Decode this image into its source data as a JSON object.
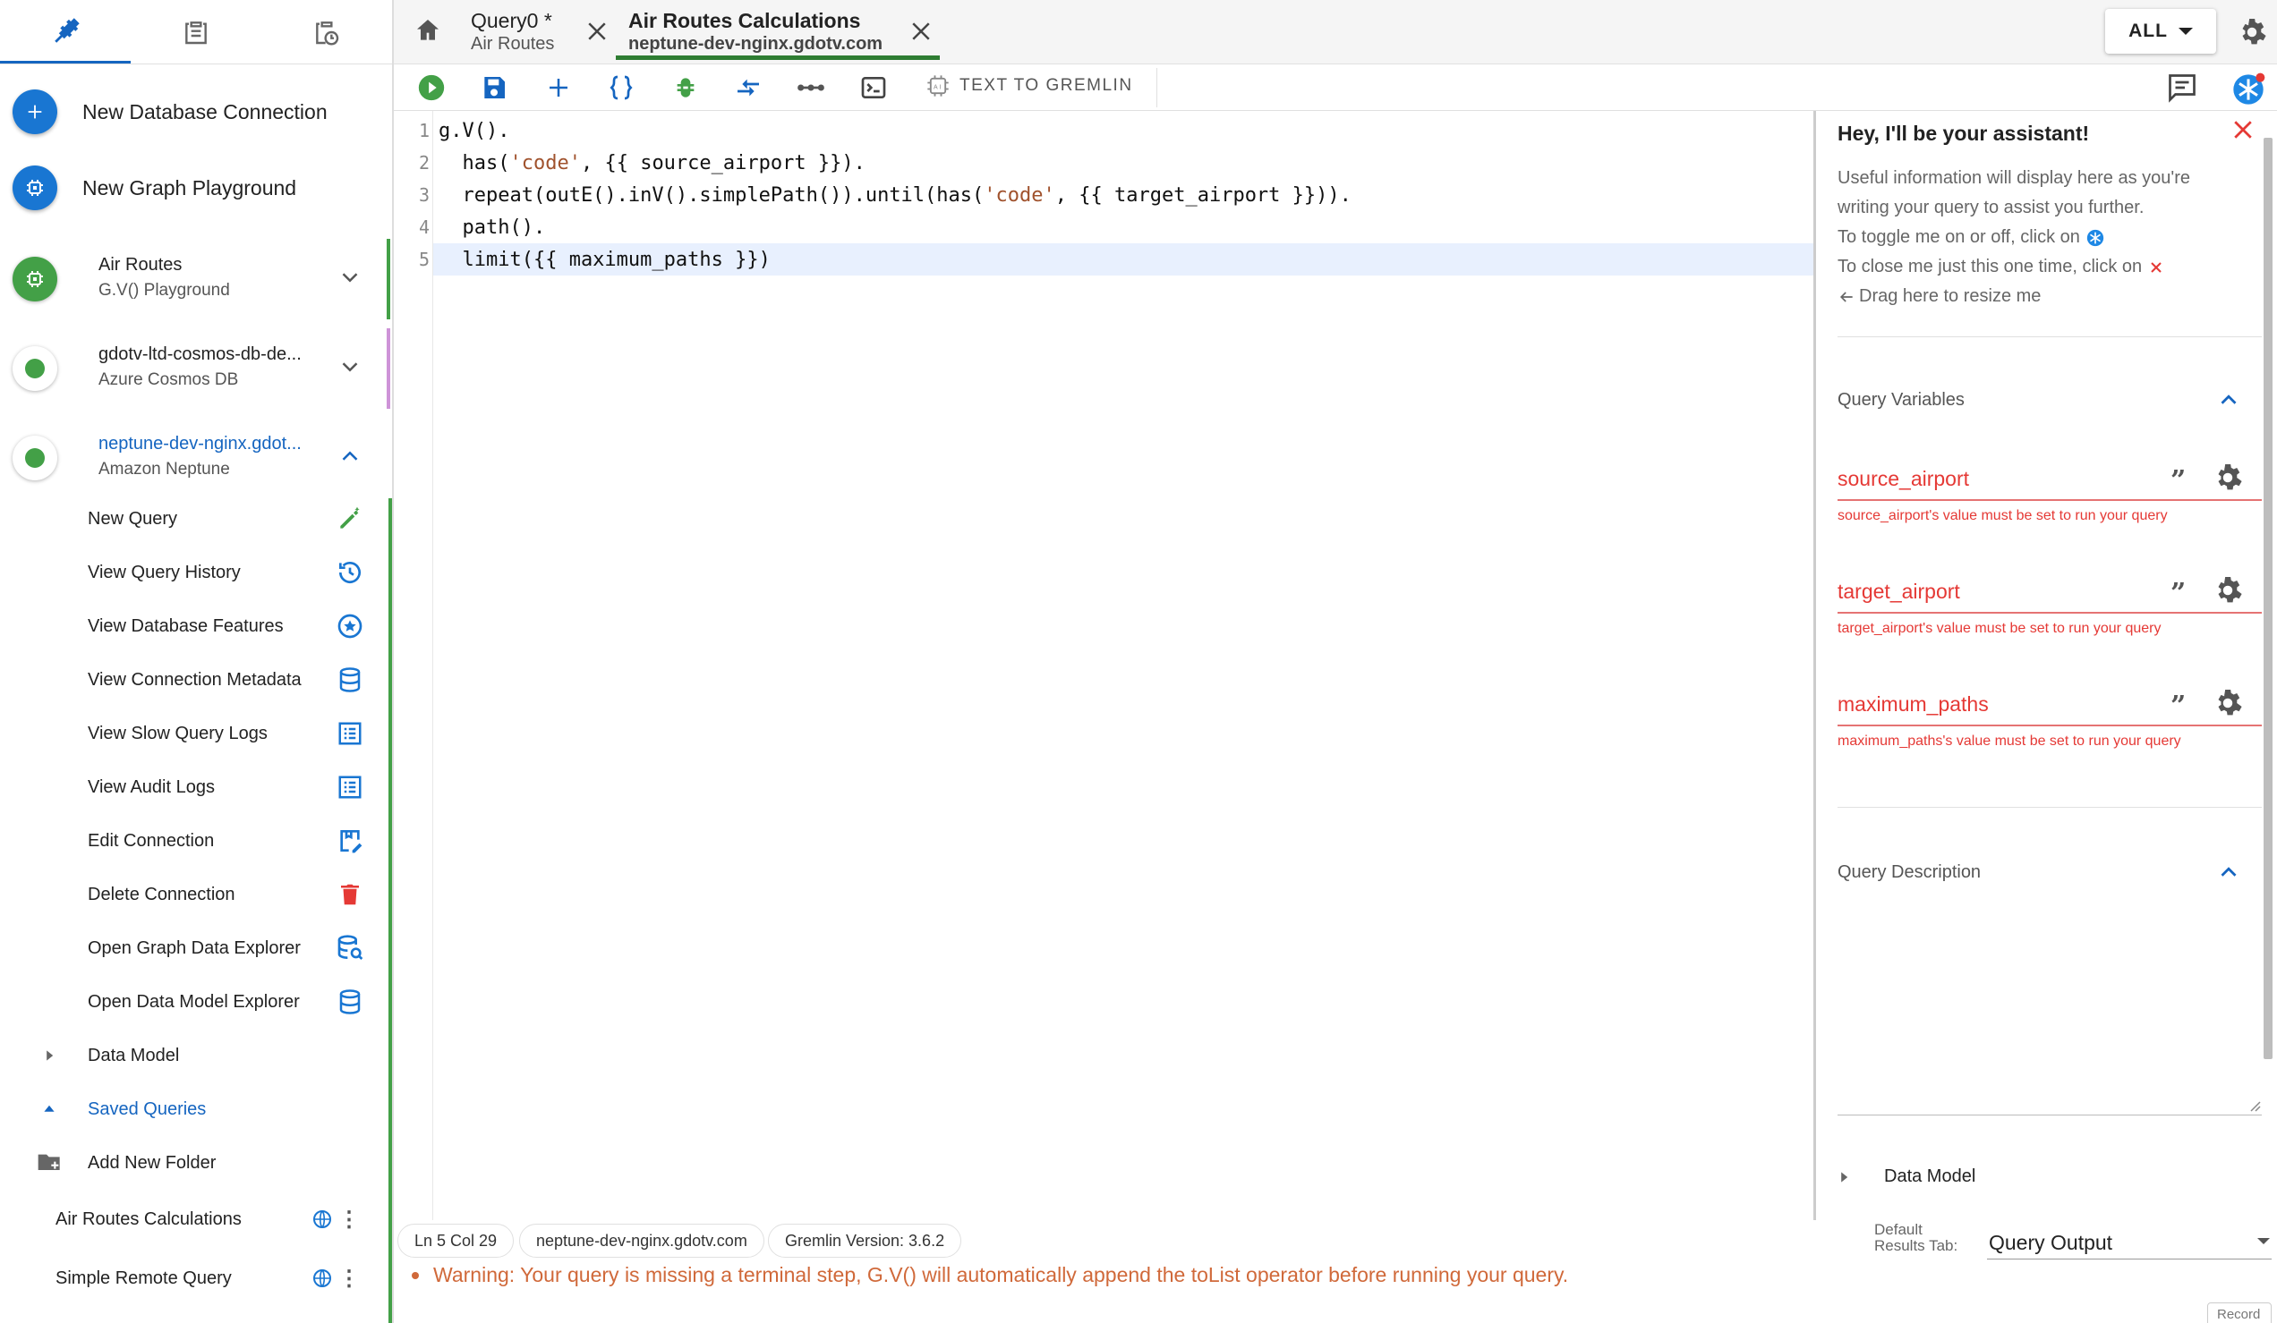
{
  "sidebar": {
    "tabs": [
      "connections-icon",
      "clipboard-icon",
      "scheduled-icon"
    ],
    "actions": {
      "new_db_connection": "New Database Connection",
      "new_graph_playground": "New Graph Playground"
    },
    "connections": [
      {
        "name": "Air Routes",
        "sub": "G.V() Playground"
      },
      {
        "name": "gdotv-ltd-cosmos-db-de...",
        "sub": "Azure Cosmos DB"
      },
      {
        "name": "neptune-dev-nginx.gdot...",
        "sub": "Amazon Neptune"
      }
    ],
    "menu": [
      {
        "label": "New Query"
      },
      {
        "label": "View Query History"
      },
      {
        "label": "View Database Features"
      },
      {
        "label": "View Connection Metadata"
      },
      {
        "label": "View Slow Query Logs"
      },
      {
        "label": "View Audit Logs"
      },
      {
        "label": "Edit Connection"
      },
      {
        "label": "Delete Connection"
      },
      {
        "label": "Open Graph Data Explorer"
      },
      {
        "label": "Open Data Model Explorer"
      }
    ],
    "tree": {
      "data_model": "Data Model",
      "saved_queries": "Saved Queries",
      "add_folder": "Add New Folder"
    },
    "saved": [
      {
        "label": "Air Routes Calculations"
      },
      {
        "label": "Simple Remote Query"
      }
    ]
  },
  "tabs": [
    {
      "title": "Query0 *",
      "sub": "Air Routes"
    },
    {
      "title": "Air Routes Calculations",
      "sub": "neptune-dev-nginx.gdotv.com"
    }
  ],
  "topbar": {
    "filter": "ALL"
  },
  "toolbar": {
    "text_to_gremlin": "TEXT TO GREMLIN"
  },
  "editor": {
    "line_numbers": [
      "1",
      "2",
      "3",
      "4",
      "5"
    ]
  },
  "assistant": {
    "title": "Hey, I'll be your assistant!",
    "info": [
      "Useful information will display here as you're",
      "writing your query to assist you further.",
      "To toggle me on or off, click on",
      "To close me just this one time, click on",
      "Drag here to resize me"
    ],
    "query_variables_heading": "Query Variables",
    "variables": [
      {
        "name": "source_airport",
        "error": "source_airport's value must be set to run your query"
      },
      {
        "name": "target_airport",
        "error": "target_airport's value must be set to run your query"
      },
      {
        "name": "maximum_paths",
        "error": "maximum_paths's value must be set to run your query"
      }
    ],
    "query_description_heading": "Query Description",
    "data_model": "Data Model"
  },
  "status": {
    "position": "Ln 5 Col 29",
    "host": "neptune-dev-nginx.gdotv.com",
    "gremlin_version": "Gremlin Version: 3.6.2",
    "default_results_label_1": "Default",
    "default_results_label_2": "Results Tab:",
    "default_results_value": "Query Output",
    "warning": "Warning: Your query is missing a terminal step, G.V() will automatically append the toList operator before running your query.",
    "record": "Record"
  },
  "colors": {
    "accent": "#1976d2",
    "success": "#43a047",
    "error": "#e53935",
    "warning": "#d0693a"
  }
}
